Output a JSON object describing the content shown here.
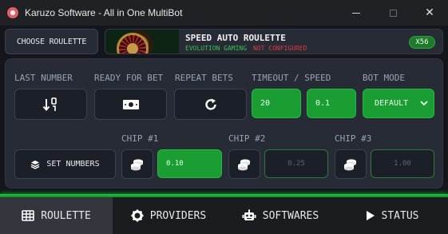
{
  "window": {
    "title": "Karuzo Software - All in One MultiBot",
    "close_glyph": "✕"
  },
  "top": {
    "choose_label": "CHOOSE ROULETTE",
    "game_name": "SPEED AUTO ROULETTE",
    "provider": "EVOLUTION GAMING",
    "status": "NOT CONFIGURED",
    "status_color": "#e23b3b",
    "badge": "X56"
  },
  "controls": {
    "last_number_label": "LAST NUMBER",
    "ready_label": "READY FOR BET",
    "repeat_label": "REPEAT BETS",
    "timeout_label": "TIMEOUT / SPEED",
    "timeout_value": "20",
    "speed_value": "0.1",
    "bot_mode_label": "BOT MODE",
    "bot_mode_value": "DEFAULT",
    "set_numbers_label": "SET NUMBERS"
  },
  "chips": [
    {
      "label": "CHIP #1",
      "value": "0.10",
      "active": true
    },
    {
      "label": "CHIP #2",
      "value": "0.25",
      "active": false
    },
    {
      "label": "CHIP #3",
      "value": "1.00",
      "active": false
    }
  ],
  "tabs": [
    {
      "label": "ROULETTE",
      "icon": "table-icon",
      "active": true
    },
    {
      "label": "PROVIDERS",
      "icon": "gear-icon",
      "active": false
    },
    {
      "label": "SOFTWARES",
      "icon": "robot-icon",
      "active": false
    },
    {
      "label": "STATUS",
      "icon": "play-icon",
      "active": false
    }
  ],
  "colors": {
    "accent_green": "#1a9e33",
    "provider_green": "#38c24a",
    "background": "#14161b",
    "panel": "#262b36"
  }
}
